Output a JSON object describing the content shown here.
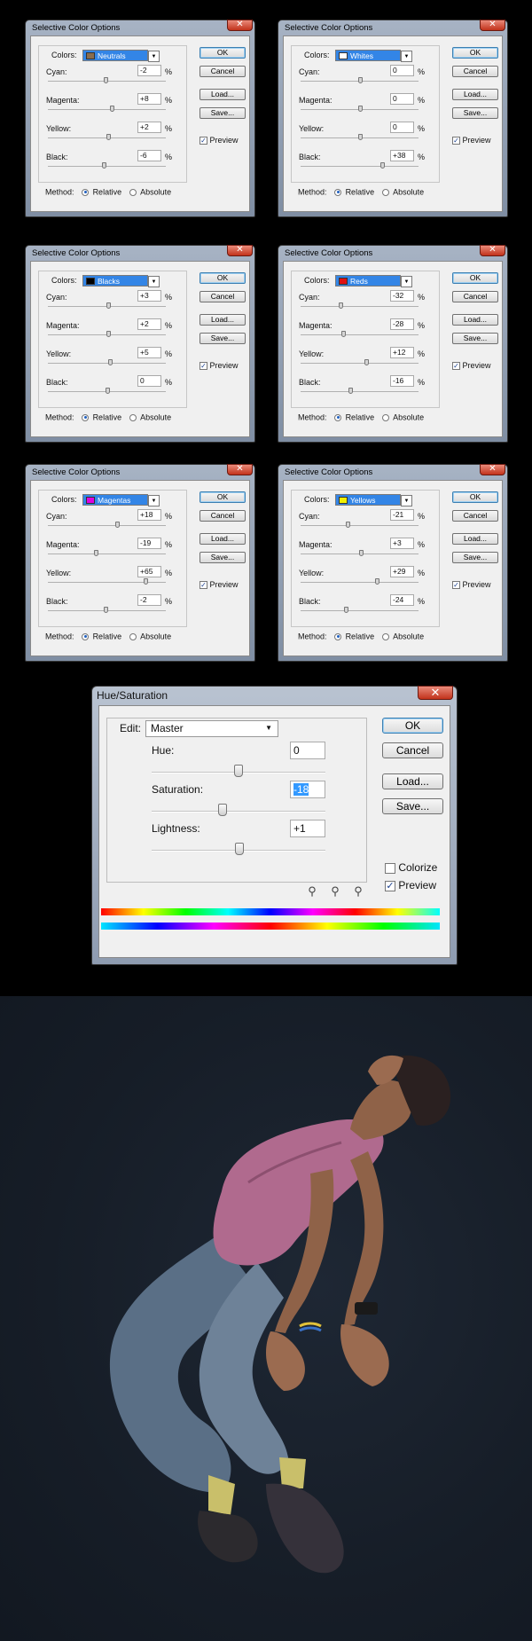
{
  "selective_color": {
    "title": "Selective Color Options",
    "colors_label": "Colors:",
    "method_label": "Method:",
    "method_options": [
      "Relative",
      "Absolute"
    ],
    "method_selected": "Relative",
    "buttons": {
      "ok": "OK",
      "cancel": "Cancel",
      "load": "Load...",
      "save": "Save..."
    },
    "preview_label": "Preview",
    "preview_checked": true,
    "slider_labels": [
      "Cyan:",
      "Magenta:",
      "Yellow:",
      "Black:"
    ],
    "percent_sign": "%",
    "dialogs": [
      {
        "color": "Neutrals",
        "swatch": "#8a6d4e",
        "values": [
          "-2",
          "+8",
          "+2",
          "-6"
        ],
        "levels": [
          -2,
          8,
          2,
          -6
        ]
      },
      {
        "color": "Whites",
        "swatch": "#ffffff",
        "values": [
          "0",
          "0",
          "0",
          "+38"
        ],
        "levels": [
          0,
          0,
          0,
          38
        ]
      },
      {
        "color": "Blacks",
        "swatch": "#000000",
        "values": [
          "+3",
          "+2",
          "+5",
          "0"
        ],
        "levels": [
          3,
          2,
          5,
          0
        ]
      },
      {
        "color": "Reds",
        "swatch": "#e01010",
        "values": [
          "-32",
          "-28",
          "+12",
          "-16"
        ],
        "levels": [
          -32,
          -28,
          12,
          -16
        ]
      },
      {
        "color": "Magentas",
        "swatch": "#e000e0",
        "values": [
          "+18",
          "-19",
          "+65",
          "-2"
        ],
        "levels": [
          18,
          -19,
          65,
          -2
        ]
      },
      {
        "color": "Yellows",
        "swatch": "#f0f000",
        "values": [
          "-21",
          "+3",
          "+29",
          "-24"
        ],
        "levels": [
          -21,
          3,
          29,
          -24
        ]
      }
    ]
  },
  "hue_saturation": {
    "title": "Hue/Saturation",
    "edit_label": "Edit:",
    "edit_value": "Master",
    "hue_label": "Hue:",
    "hue_value": "0",
    "hue_level": 0,
    "saturation_label": "Saturation:",
    "saturation_value": "-18",
    "saturation_level": -18,
    "lightness_label": "Lightness:",
    "lightness_value": "+1",
    "lightness_level": 1,
    "buttons": {
      "ok": "OK",
      "cancel": "Cancel",
      "load": "Load...",
      "save": "Save..."
    },
    "colorize_label": "Colorize",
    "colorize_checked": false,
    "preview_label": "Preview",
    "preview_checked": true
  },
  "icons": {
    "close": "close-icon",
    "dropdown": "chevron-down-icon",
    "eyedropper": "eyedropper-icon"
  },
  "colors": {
    "title_bar": "#9aa6b8",
    "selection_blue": "#3385e6",
    "close_red": "#c2321b",
    "photo_bg": "#161d27",
    "shirt": "#b06a8e"
  }
}
